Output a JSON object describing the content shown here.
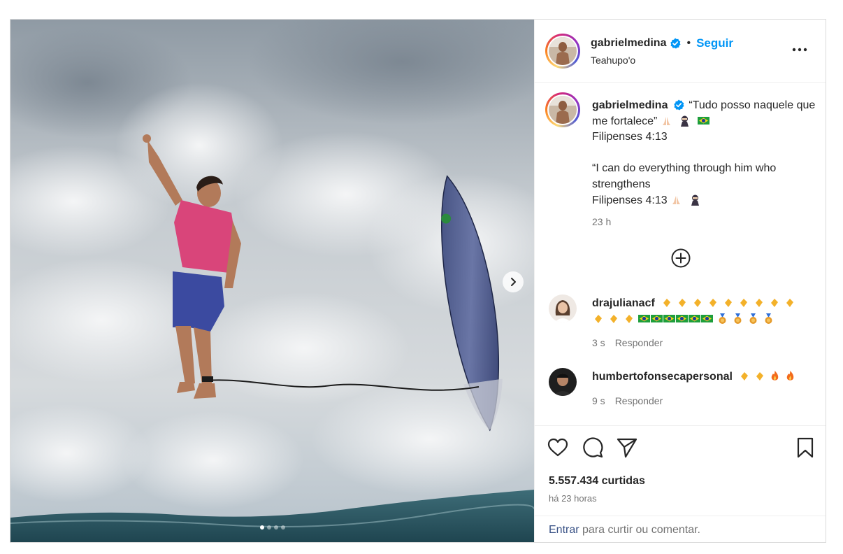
{
  "post": {
    "author": {
      "username": "gabrielmedina",
      "verified": true,
      "follow_label": "Seguir",
      "separator": "•",
      "location": "Teahupo'o"
    },
    "caption": {
      "line1": "“Tudo posso naquele que me fortalece”",
      "line1_emoji": [
        "pray-icon",
        "ninja-icon",
        "brazil-flag-icon"
      ],
      "line2": "Filipenses 4:13",
      "line3": "“I can do everything through him who strengthens",
      "line4": "Filipenses 4:13",
      "line4_emoji": [
        "pray-icon",
        "ninja-icon"
      ],
      "time": "23 h"
    },
    "comments": [
      {
        "username": "drajulianacf",
        "emoji": [
          "clap x9",
          "clap x3",
          "brazil-flag x6",
          "medal x4"
        ],
        "time": "3 s",
        "reply_label": "Responder"
      },
      {
        "username": "humbertofonsecapersonal",
        "emoji": [
          "clap x2",
          "fire x2"
        ],
        "time": "9 s",
        "reply_label": "Responder"
      }
    ],
    "likes_text": "5.557.434 curtidas",
    "posted_ago": "há 23 horas",
    "footer": {
      "login_label": "Entrar",
      "text": "para curtir ou comentar."
    },
    "carousel": {
      "slide_count": 4,
      "active_slide": 1
    },
    "colors": {
      "follow_blue": "#0095f6",
      "verified_blue": "#0095f6",
      "meta_gray": "#737373",
      "text": "#262626"
    }
  }
}
